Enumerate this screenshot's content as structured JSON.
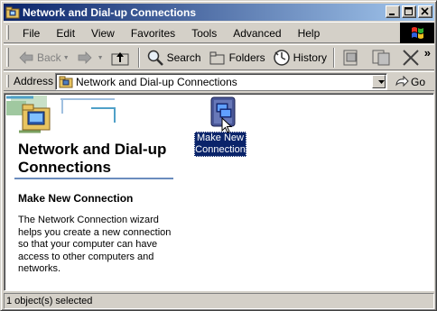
{
  "window": {
    "title": "Network and Dial-up Connections",
    "title_icon": "network-folder-icon"
  },
  "menu": {
    "items": [
      "File",
      "Edit",
      "View",
      "Favorites",
      "Tools",
      "Advanced",
      "Help"
    ]
  },
  "toolbar": {
    "back_label": "Back",
    "back_enabled": false,
    "forward_enabled": false,
    "search_label": "Search",
    "folders_label": "Folders",
    "history_label": "History",
    "more_label": "»"
  },
  "address": {
    "label": "Address",
    "value": "Network and Dial-up Connections",
    "go_label": "Go"
  },
  "left_panel": {
    "title": "Network and Dial-up Connections",
    "heading": "Make New Connection",
    "description": "The Network Connection wizard helps you create a new connection so that your computer can have access to other computers and networks."
  },
  "items": [
    {
      "label": "Make New Connection",
      "icon": "make-new-connection-icon",
      "selected": true
    }
  ],
  "status": {
    "text": "1 object(s) selected"
  },
  "colors": {
    "titlebar_start": "#0a246a",
    "titlebar_end": "#a6caf0",
    "selection": "#0a246a",
    "chrome": "#d4d0c8"
  }
}
